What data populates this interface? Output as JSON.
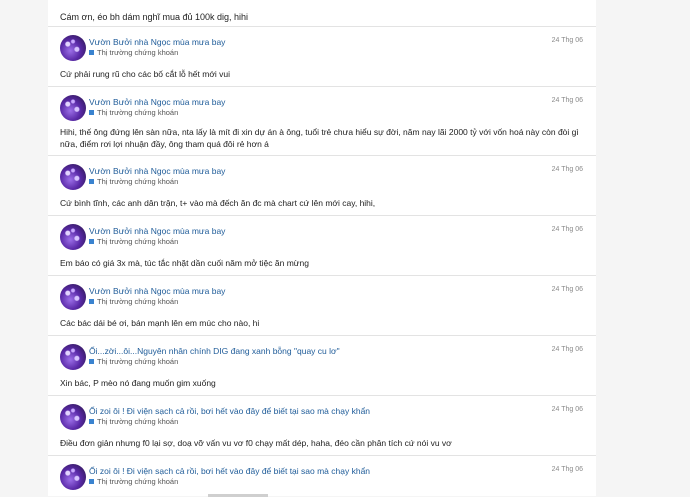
{
  "top_comment": {
    "text": "Cám ơn, éo bh dám nghĩ mua đủ 100k dig, hihi"
  },
  "posts": [
    {
      "author": "Vườn Bưởi nhà Ngọc mùa mưa bay",
      "category": "Thị trường chứng khoán",
      "date": "24 Thg 06",
      "content": "Cứ phải rung rũ cho các bố cắt lỗ hết mới vui"
    },
    {
      "author": "Vườn Bưởi nhà Ngọc mùa mưa bay",
      "category": "Thị trường chứng khoán",
      "date": "24 Thg 06",
      "content": "Hihi, thế ông đứng lên sàn nữa, nta lấy là mít đi xin dự án à ông, tuổi trẻ chưa hiểu sự đời, năm nay lãi 2000 tỷ với vốn hoá này còn đòi gì nữa, điểm rơi lợi nhuận đầy, ông tham quá đôi rẻ hơn á"
    },
    {
      "author": "Vườn Bưởi nhà Ngọc mùa mưa bay",
      "category": "Thị trường chứng khoán",
      "date": "24 Thg 06",
      "content": "Cứ bình tĩnh, các anh dân trận, t+ vào mà đếch ăn đc mà chart cứ lên mới cay, hihi,"
    },
    {
      "author": "Vườn Bưởi nhà Ngọc mùa mưa bay",
      "category": "Thị trường chứng khoán",
      "date": "24 Thg 06",
      "content": "Em báo có giá 3x mà, túc tắc nhặt dần cuối năm mở tiệc ăn mừng"
    },
    {
      "author": "Vườn Bưởi nhà Ngọc mùa mưa bay",
      "category": "Thị trường chứng khoán",
      "date": "24 Thg 06",
      "content": "Các bác dái bé ơi, bán mạnh lên em múc cho nào, hi"
    },
    {
      "author": "Ối...zời...ôi...Nguyên nhân chính DIG đang xanh bỗng \"quay cu lơ\"",
      "category": "Thị trường chứng khoán",
      "date": "24 Thg 06",
      "content": "Xin bác, P mèo nó đang muốn gim xuống"
    },
    {
      "author": "Ối zoi ôi ! Đi viện sạch cả rồi, bơi hết vào đây để biết tại sao mà chạy khẩn",
      "category": "Thị trường chứng khoán",
      "date": "24 Thg 06",
      "content": "Điều đơn giản nhưng f0 lại sợ, doạ vỡ vấn vu vơ f0 chạy mất dép, haha, đéo cần phân tích cứ nói vu vơ"
    },
    {
      "author": "Ối zoi ôi ! Đi viện sạch cả rồi, bơi hết vào đây để biết tại sao mà chạy khẩn",
      "category": "Thị trường chứng khoán",
      "date": "24 Thg 06",
      "content": ""
    }
  ]
}
